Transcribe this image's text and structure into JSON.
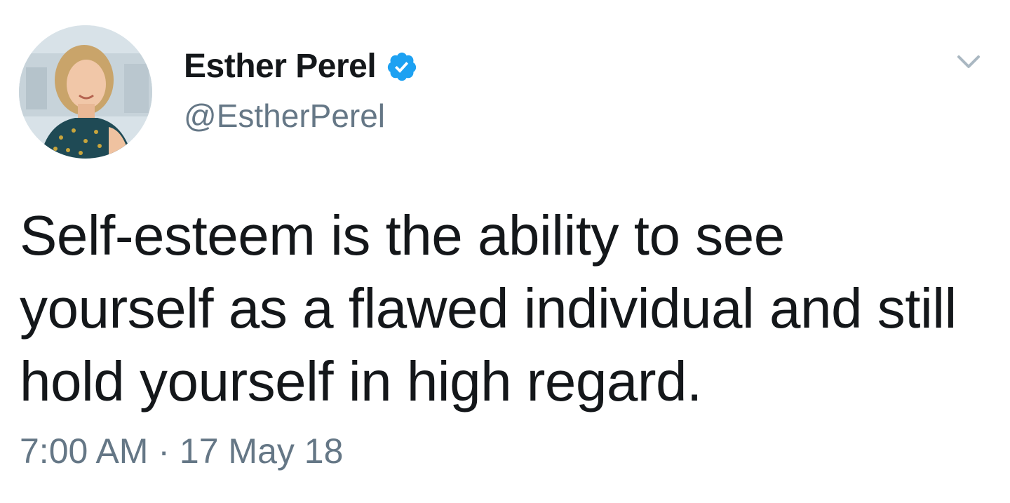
{
  "tweet": {
    "author": {
      "display_name": "Esther Perel",
      "handle": "@EstherPerel",
      "verified": true,
      "verified_icon": "verified-badge-icon",
      "verified_color": "#1da1f2"
    },
    "text": "Self-esteem is the ability to see yourself as a flawed individual and still hold yourself in high regard.",
    "time": "7:00 AM",
    "separator": "·",
    "date": "17 May 18",
    "menu_icon": "chevron-down-icon"
  },
  "colors": {
    "text_primary": "#14171a",
    "text_secondary": "#657786",
    "icon_muted": "#aab8c2"
  }
}
